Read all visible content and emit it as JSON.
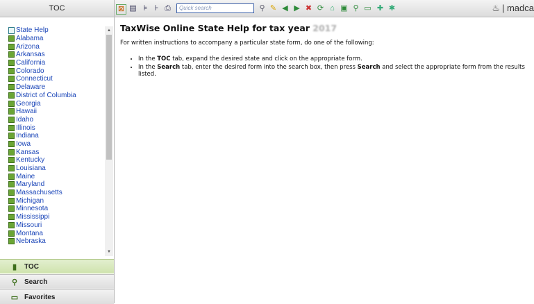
{
  "left_header": {
    "title": "TOC"
  },
  "toolbar": {
    "search_placeholder": "Quick search",
    "brand_text": "| madca"
  },
  "tree": {
    "root": "State Help",
    "items": [
      "Alabama",
      "Arizona",
      "Arkansas",
      "California",
      "Colorado",
      "Connecticut",
      "Delaware",
      "District of Columbia",
      "Georgia",
      "Hawaii",
      "Idaho",
      "Illinois",
      "Indiana",
      "Iowa",
      "Kansas",
      "Kentucky",
      "Louisiana",
      "Maine",
      "Maryland",
      "Massachusetts",
      "Michigan",
      "Minnesota",
      "Mississippi",
      "Missouri",
      "Montana",
      "Nebraska"
    ]
  },
  "tabs": {
    "toc": "TOC",
    "search": "Search",
    "favorites": "Favorites"
  },
  "content": {
    "title": "TaxWise Online State Help for tax year",
    "title_year": "2017",
    "intro": "For written instructions to accompany a particular state form, do one of the following:",
    "step1": {
      "a": "In the ",
      "b": "TOC",
      "c": " tab, expand the desired state and click on the appropriate form."
    },
    "step2": {
      "a": "In the ",
      "b": "Search",
      "c": " tab, enter the desired form into the search box, then press ",
      "d": "Search",
      "e": " and select the appropriate form from the results listed."
    }
  },
  "colors": {
    "link": "#1a45b8",
    "active_tab": "#d5e6b8",
    "book": "#6aa534"
  }
}
